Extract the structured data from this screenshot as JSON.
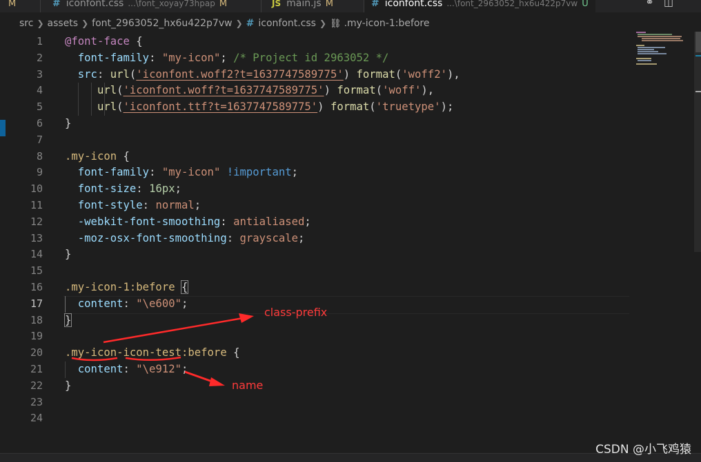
{
  "tabs": [
    {
      "label": "iconfont.css",
      "path": "...\\font_xoyay73hpap",
      "status": "M"
    },
    {
      "label": "main.js",
      "status": "M"
    },
    {
      "label": "iconfont.css",
      "path": "...\\font_2963052_hx6u422p7vw",
      "status": "U"
    }
  ],
  "tab_left_status": "M",
  "breadcrumb": {
    "items": [
      "src",
      "assets",
      "font_2963052_hx6u422p7vw",
      "iconfont.css",
      ".my-icon-1:before"
    ]
  },
  "editor": {
    "current_line": 17,
    "line_numbers": [
      "1",
      "2",
      "3",
      "4",
      "5",
      "6",
      "7",
      "8",
      "9",
      "10",
      "11",
      "12",
      "13",
      "14",
      "15",
      "16",
      "17",
      "18",
      "19",
      "20",
      "21",
      "22",
      "23",
      "24"
    ],
    "code": {
      "l1_at": "@font-face",
      "l1_brace": " {",
      "l2_prop": "font-family",
      "l2_colon": ": ",
      "l2_str": "\"my-icon\"",
      "l2_semi": "; ",
      "l2_comment": "/* Project id 2963052 */",
      "l3_prop": "src",
      "l3_colon": ": ",
      "l3_fn1": "url",
      "l3_p1": "(",
      "l3_url": "'iconfont.woff2?t=1637747589775'",
      "l3_p2": ") ",
      "l3_fn2": "format",
      "l3_p3": "(",
      "l3_fmt": "'woff2'",
      "l3_p4": "),",
      "l4_fn1": "url",
      "l4_p1": "(",
      "l4_url": "'iconfont.woff?t=1637747589775'",
      "l4_p2": ") ",
      "l4_fn2": "format",
      "l4_p3": "(",
      "l4_fmt": "'woff'",
      "l4_p4": "),",
      "l5_fn1": "url",
      "l5_p1": "(",
      "l5_url": "'iconfont.ttf?t=1637747589775'",
      "l5_p2": ") ",
      "l5_fn2": "format",
      "l5_p3": "(",
      "l5_fmt": "'truetype'",
      "l5_p4": ");",
      "l6": "}",
      "l8_sel": ".my-icon",
      "l8_brace": " {",
      "l9_prop": "font-family",
      "l9_colon": ": ",
      "l9_str": "\"my-icon\"",
      "l9_imp": " !important",
      "l9_semi": ";",
      "l10_prop": "font-size",
      "l10_colon": ": ",
      "l10_num": "16px",
      "l10_semi": ";",
      "l11_prop": "font-style",
      "l11_colon": ": ",
      "l11_val": "normal",
      "l11_semi": ";",
      "l12_prop": "-webkit-font-smoothing",
      "l12_colon": ": ",
      "l12_val": "antialiased",
      "l12_semi": ";",
      "l13_prop": "-moz-osx-font-smoothing",
      "l13_colon": ": ",
      "l13_val": "grayscale",
      "l13_semi": ";",
      "l14": "}",
      "l16_sel": ".my-icon-1:before",
      "l16_sp": " ",
      "l16_brace": "{",
      "l17_prop": "content",
      "l17_colon": ": ",
      "l17_str": "\"\\e600\"",
      "l17_semi": ";",
      "l18": "}",
      "l20_sel": ".my-icon-icon-test:before",
      "l20_brace": " {",
      "l21_prop": "content",
      "l21_colon": ": ",
      "l21_str": "\"\\e912\"",
      "l21_semi": ";",
      "l22": "}"
    }
  },
  "annotations": {
    "class_prefix": "class-prefix",
    "name": "name",
    "color": "#ff3b3b"
  },
  "watermark": "CSDN @小飞鸡猿",
  "colors": {
    "background": "#1e1e1e",
    "keyword": "#c586c0",
    "selector": "#d7ba7d",
    "property": "#9cdcfe",
    "string": "#ce9178",
    "number": "#b5cea8",
    "comment": "#6a9955",
    "function": "#dcdcaa"
  }
}
